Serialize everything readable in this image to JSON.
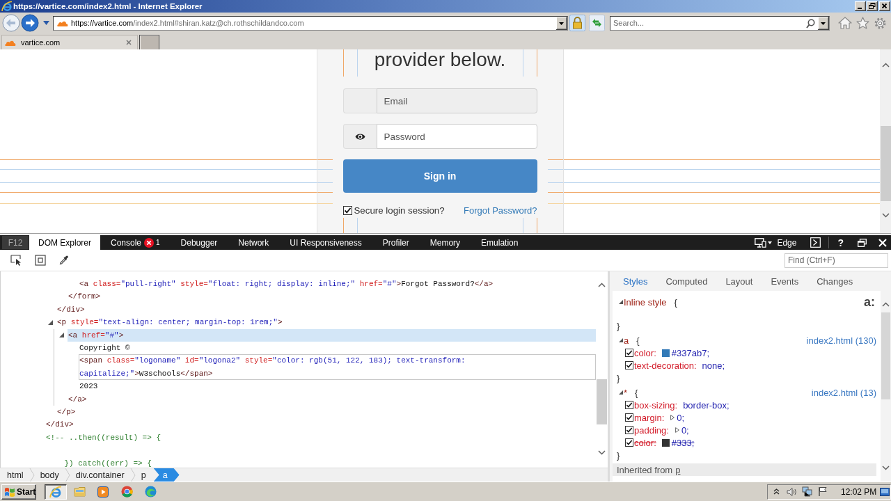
{
  "window": {
    "title": "https://vartice.com/index2.html - Internet Explorer"
  },
  "address_bar": {
    "host": "https://vartice.com",
    "path": "/index2.html#shiran.katz@ch.rothschildandco.com"
  },
  "search": {
    "placeholder": "Search..."
  },
  "browser_tabs": [
    {
      "label": "vartice.com",
      "selected": true
    }
  ],
  "page": {
    "heading": "provider below.",
    "fields": [
      {
        "kind": "email",
        "placeholder": "Email",
        "disabled": true
      },
      {
        "kind": "password",
        "placeholder": "Password",
        "disabled": false
      }
    ],
    "submit": "Sign in",
    "remember": {
      "label": "Secure login session?",
      "checked": true
    },
    "forgot_link": "Forgot Password?"
  },
  "devtools": {
    "f12": "F12",
    "tabs": [
      {
        "label": "DOM Explorer",
        "selected": true
      },
      {
        "label": "Console",
        "selected": false,
        "errors": "1"
      },
      {
        "label": "Debugger",
        "selected": false
      },
      {
        "label": "Network",
        "selected": false
      },
      {
        "label": "UI Responsiveness",
        "selected": false
      },
      {
        "label": "Profiler",
        "selected": false
      },
      {
        "label": "Memory",
        "selected": false
      },
      {
        "label": "Emulation",
        "selected": false
      }
    ],
    "document_mode": "Edge",
    "help": "?",
    "find": {
      "placeholder": "Find (Ctrl+F)"
    },
    "dom_tree": [
      {
        "selected": false,
        "children": [
          {
            "selected": false,
            "children": [
              {
                "selected": false,
                "children": [
                  {
                    "selected": false,
                    "open": "<a class=\"pull-right\" style=\"float: right; display: inline;\" href=\"#\">Forgot Password?</a>"
                  }
                ],
                "close": "</form>"
              }
            ],
            "close": "</div>"
          },
          {
            "selected": false,
            "expanded": true,
            "open": "<p style=\"text-align: center; margin-top: 1rem;\">",
            "children": [
              {
                "selected": true,
                "expanded": true,
                "open": "<a href=\"#\">",
                "children": [
                  {
                    "selected": false,
                    "open": "Copyright ©"
                  },
                  {
                    "selected": false,
                    "hovered": true,
                    "open": "<span class=\"logoname\" id=\"logona2\" style=\"color: rgb(51, 122, 183); text-transform: capitalize;\">W3schools</span>"
                  },
                  {
                    "selected": false,
                    "open": "2023"
                  }
                ],
                "close": "</a>"
              }
            ],
            "close": "</p>"
          }
        ],
        "close": "</div>"
      },
      {
        "selected": false,
        "open": "<!-- ..then((result) => {\n\n    }) catch((err) => {"
      }
    ],
    "breadcrumb": [
      {
        "label": "html",
        "selected": false
      },
      {
        "label": "body",
        "selected": false
      },
      {
        "label": "div.container",
        "selected": false
      },
      {
        "label": "p",
        "selected": false
      },
      {
        "label": "a",
        "selected": true
      }
    ],
    "style_tabs": [
      {
        "label": "Styles",
        "selected": true
      },
      {
        "label": "Computed",
        "selected": false
      },
      {
        "label": "Layout",
        "selected": false
      },
      {
        "label": "Events",
        "selected": false
      },
      {
        "label": "Changes",
        "selected": false
      }
    ],
    "pseudo_toggle": "a:",
    "rules": [
      {
        "selector": "Inline style",
        "open": "{",
        "close": "}",
        "expanded": true
      },
      {
        "selector": "a",
        "open": "{",
        "close": "}",
        "source": "index2.html (130)",
        "expanded": true,
        "properties": [
          {
            "name": "color:",
            "value": "#337ab7;",
            "color": "#337ab7",
            "checked": true,
            "overridden": false
          },
          {
            "name": "text-decoration:",
            "value": "none;",
            "checked": true,
            "overridden": false
          }
        ]
      },
      {
        "selector": "*",
        "open": "{",
        "close": "}",
        "source": "index2.html (13)",
        "expanded": true,
        "properties": [
          {
            "name": "box-sizing:",
            "value": "border-box;",
            "checked": true,
            "overridden": false
          },
          {
            "name": "margin:",
            "value": "0;",
            "expanded": false,
            "checked": true,
            "overridden": false
          },
          {
            "name": "padding:",
            "value": "0;",
            "expanded": false,
            "checked": true,
            "overridden": false
          },
          {
            "name": "color:",
            "value": "#333;",
            "color": "#333333",
            "checked": true,
            "overridden": true
          }
        ]
      }
    ],
    "inherited": {
      "label": "Inherited from",
      "element": "p"
    }
  },
  "taskbar": {
    "start": "Start",
    "apps": [
      {
        "kind": "ie",
        "active": true
      },
      {
        "kind": "folder",
        "active": false
      },
      {
        "kind": "media",
        "active": false
      },
      {
        "kind": "chrome",
        "active": false
      },
      {
        "kind": "edge",
        "active": false
      }
    ],
    "clock": "12:02 PM"
  }
}
